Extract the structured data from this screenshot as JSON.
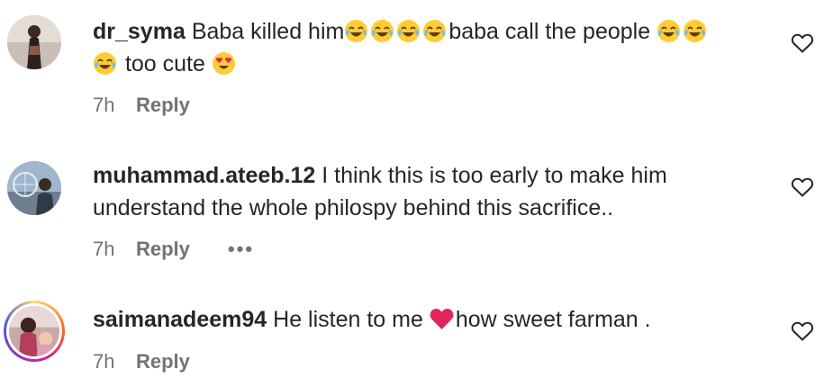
{
  "comments": [
    {
      "username": "dr_syma",
      "text_parts": [
        "Baba killed him",
        "baba call the people ",
        " too cute "
      ],
      "time": "7h",
      "reply_label": "Reply"
    },
    {
      "username": "muhammad.ateeb.12",
      "text_line1": "I think this is too early to make him",
      "text_line2": "understand the whole philospy behind this sacrifice..",
      "time": "7h",
      "reply_label": "Reply",
      "more_label": "•••"
    },
    {
      "username": "saimanadeem94",
      "text_parts": [
        "He listen to me ",
        "how sweet farman ."
      ],
      "time": "7h",
      "reply_label": "Reply"
    }
  ],
  "icons": {
    "laugh": "face-with-tears-of-joy-icon",
    "heart_eyes": "smiling-face-with-heart-eyes-icon",
    "red_heart": "red-heart-icon",
    "like": "heart-outline-icon",
    "more": "more-options-icon"
  },
  "colors": {
    "text": "#262626",
    "secondary": "#737373",
    "emoji_yellow": "#ffcc33",
    "heart_red": "#e0245e"
  }
}
